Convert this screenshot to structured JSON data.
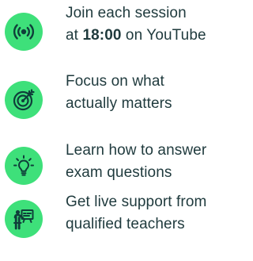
{
  "features": [
    {
      "icon": "live-broadcast-icon",
      "line1": "Join each session",
      "line2_prefix": "at ",
      "line2_time": "18:00",
      "line2_suffix": " on YouTube"
    },
    {
      "icon": "target-arrow-icon",
      "line1": "Focus on what",
      "line2": "actually matters"
    },
    {
      "icon": "lightbulb-icon",
      "line1": "Learn how to answer",
      "line2": "exam questions"
    },
    {
      "icon": "teacher-board-icon",
      "line1": "Get live support from",
      "line2": "qualified teachers"
    }
  ],
  "colors": {
    "icon_bg": "#3ee07a",
    "icon_fg": "#0f3f3a",
    "text": "#1f3a3d"
  }
}
